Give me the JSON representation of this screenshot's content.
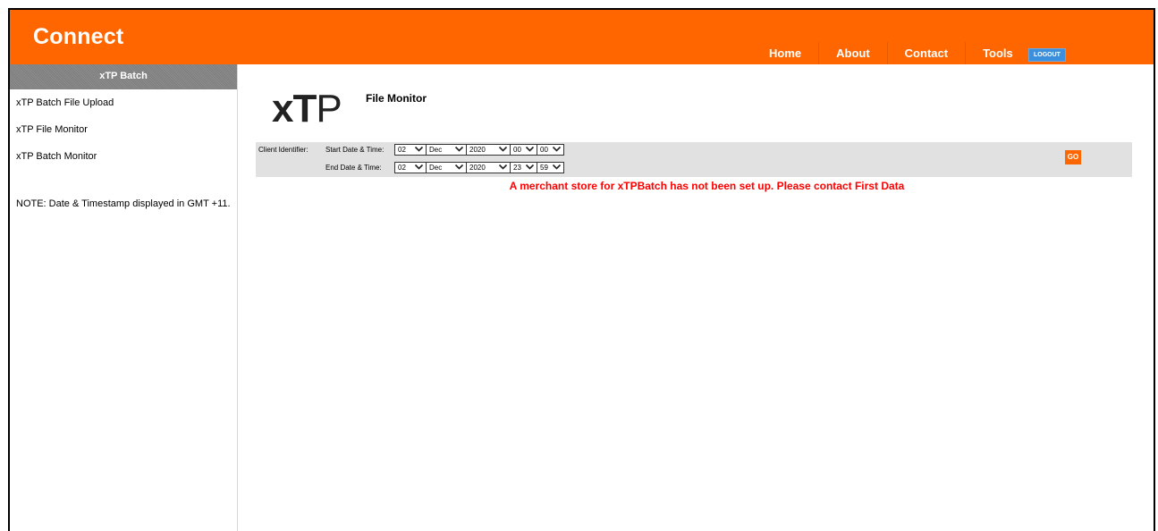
{
  "header": {
    "brand": "Connect",
    "nav": [
      "Home",
      "About",
      "Contact",
      "Tools"
    ],
    "logout": "LOGOUT"
  },
  "sidebar": {
    "heading": "xTP Batch",
    "items": [
      "xTP Batch File Upload",
      "xTP File Monitor",
      "xTP Batch Monitor"
    ],
    "note": "NOTE: Date & Timestamp displayed in GMT +11."
  },
  "main": {
    "logo_x": "x",
    "logo_t": "T",
    "logo_p": "P",
    "title": "File Monitor",
    "filter": {
      "client_label": "Client Identifier:",
      "start_label": "Start Date & Time:",
      "end_label": "End Date & Time:",
      "start": {
        "day": "02",
        "month": "Dec",
        "year": "2020",
        "hour": "00",
        "minute": "00"
      },
      "end": {
        "day": "02",
        "month": "Dec",
        "year": "2020",
        "hour": "23",
        "minute": "59"
      },
      "go_label": "GO"
    },
    "error": "A merchant store for xTPBatch has not been set up. Please contact First Data"
  },
  "colors": {
    "brand_orange": "#ff6600",
    "logout_blue": "#3c8fdc",
    "error_red": "#ff0000"
  }
}
